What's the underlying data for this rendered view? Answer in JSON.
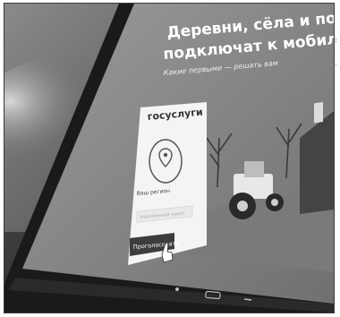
{
  "image": {
    "kind": "photo",
    "subject": "tablet-showing-gosuslugi-poll-banner"
  },
  "screen": {
    "headline_line1": "Деревни, сёла и посёлки",
    "headline_line2": "подключат к мобильному",
    "subline": "Какие первыми — решать вам",
    "card": {
      "logo": "госуслуги",
      "region_label": "Ваш регион",
      "region_placeholder": "Населённый пункт",
      "vote_button": "Проголосовать"
    }
  },
  "colors": {
    "screen_bg": "#8c8c8c",
    "card_bg": "#f4f4f4",
    "button_bg": "#3c3c3c",
    "headline": "#ffffff"
  },
  "icons": [
    "location-pin-icon",
    "tractor-illustration",
    "tree-illustration",
    "barn-illustration",
    "pointer-hand-icon"
  ]
}
